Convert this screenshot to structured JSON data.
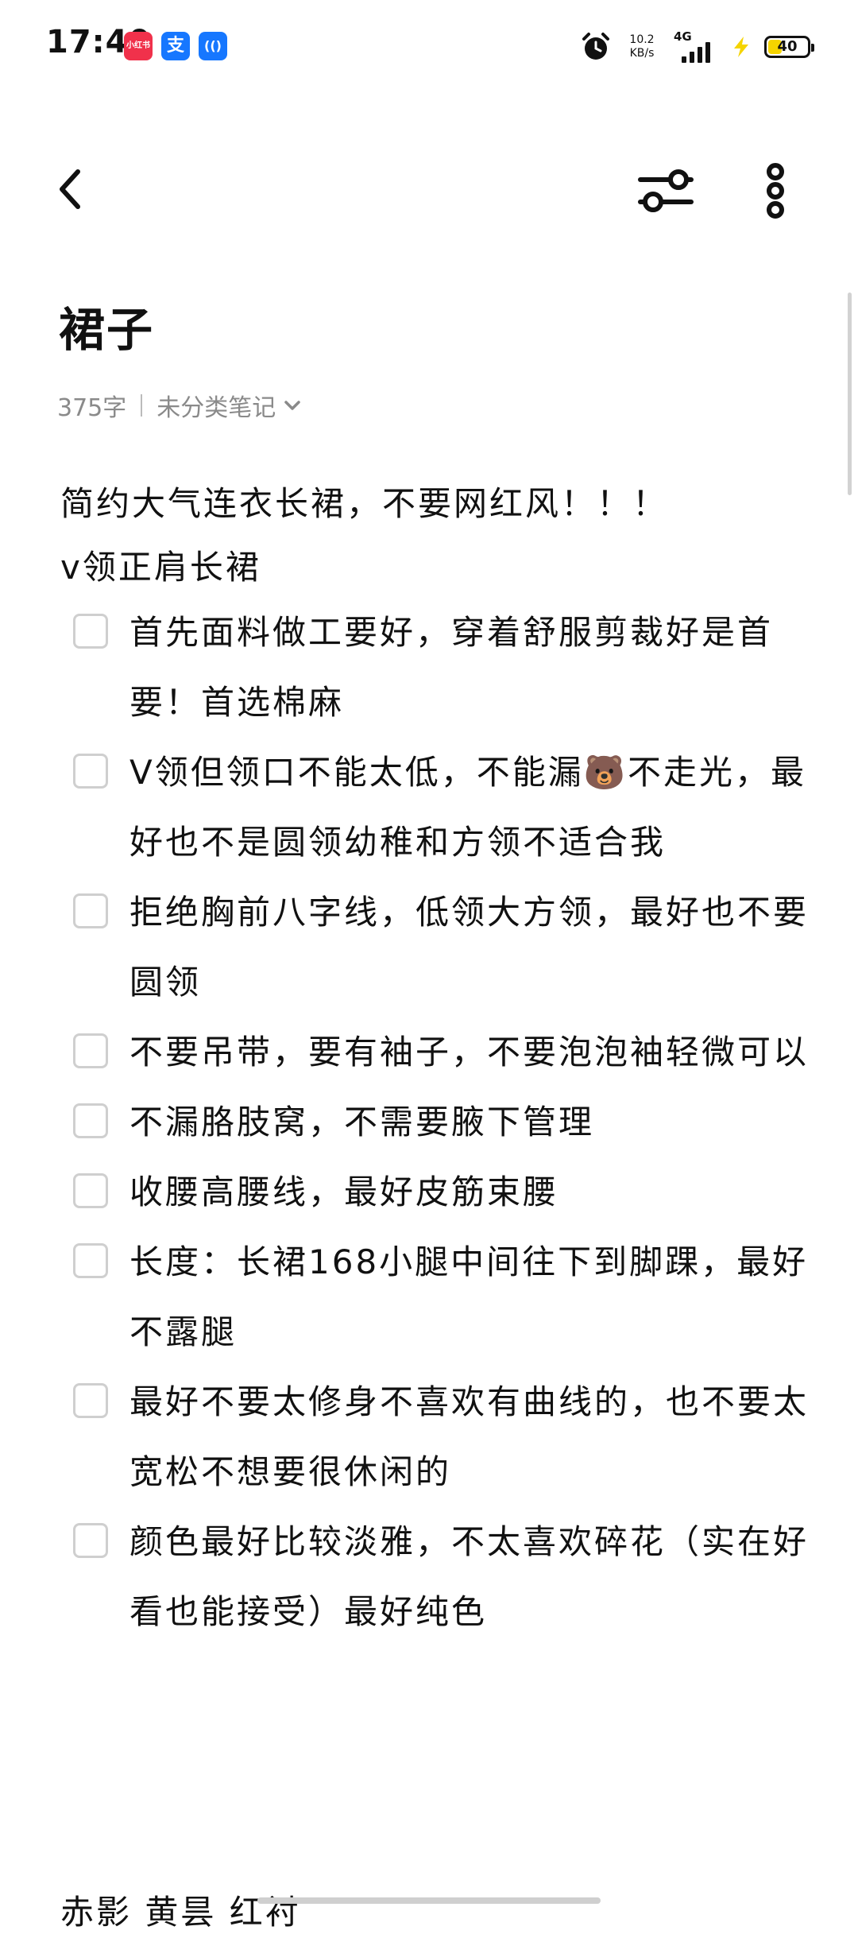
{
  "status_bar": {
    "time": "17:40",
    "app_icons": [
      "小红书",
      "支",
      "(()"
    ],
    "net_speed_value": "10.2",
    "net_speed_unit": "KB/s",
    "network_type": "4G",
    "battery": "40",
    "battery_level": 0.4,
    "accent_colors": {
      "xiaohongshu": "#f0314b",
      "alipay": "#1677ff",
      "charging": "#f5d400"
    }
  },
  "toolbar": {
    "back_icon": "chevron-left-icon",
    "filter_icon": "sliders-icon",
    "more_icon": "more-vertical-icon"
  },
  "note": {
    "title": "裙子",
    "word_count": "375字",
    "category": "未分类笔记",
    "intro": [
      "简约大气连衣长裙，不要网红风！！！",
      "v领正肩长裙"
    ],
    "checklist": [
      {
        "checked": false,
        "text": "首先面料做工要好，穿着舒服剪裁好是首要！首选棉麻"
      },
      {
        "checked": false,
        "text": "V领但领口不能太低，不能漏🐻不走光，最好也不是圆领幼稚和方领不适合我"
      },
      {
        "checked": false,
        "text": "拒绝胸前八字线，低领大方领，最好也不要圆领"
      },
      {
        "checked": false,
        "text": "不要吊带，要有袖子，不要泡泡袖轻微可以"
      },
      {
        "checked": false,
        "text": "不漏胳肢窝，不需要腋下管理"
      },
      {
        "checked": false,
        "text": "收腰高腰线，最好皮筋束腰"
      },
      {
        "checked": false,
        "text": "长度：长裙168小腿中间往下到脚踝，最好不露腿"
      },
      {
        "checked": false,
        "text": "最好不要太修身不喜欢有曲线的，也不要太宽松不想要很休闲的"
      },
      {
        "checked": false,
        "text": "颜色最好比较淡雅，不太喜欢碎花（实在好看也能接受）最好纯色"
      }
    ],
    "bottom_partial": "赤影 黄昙 红衬"
  }
}
